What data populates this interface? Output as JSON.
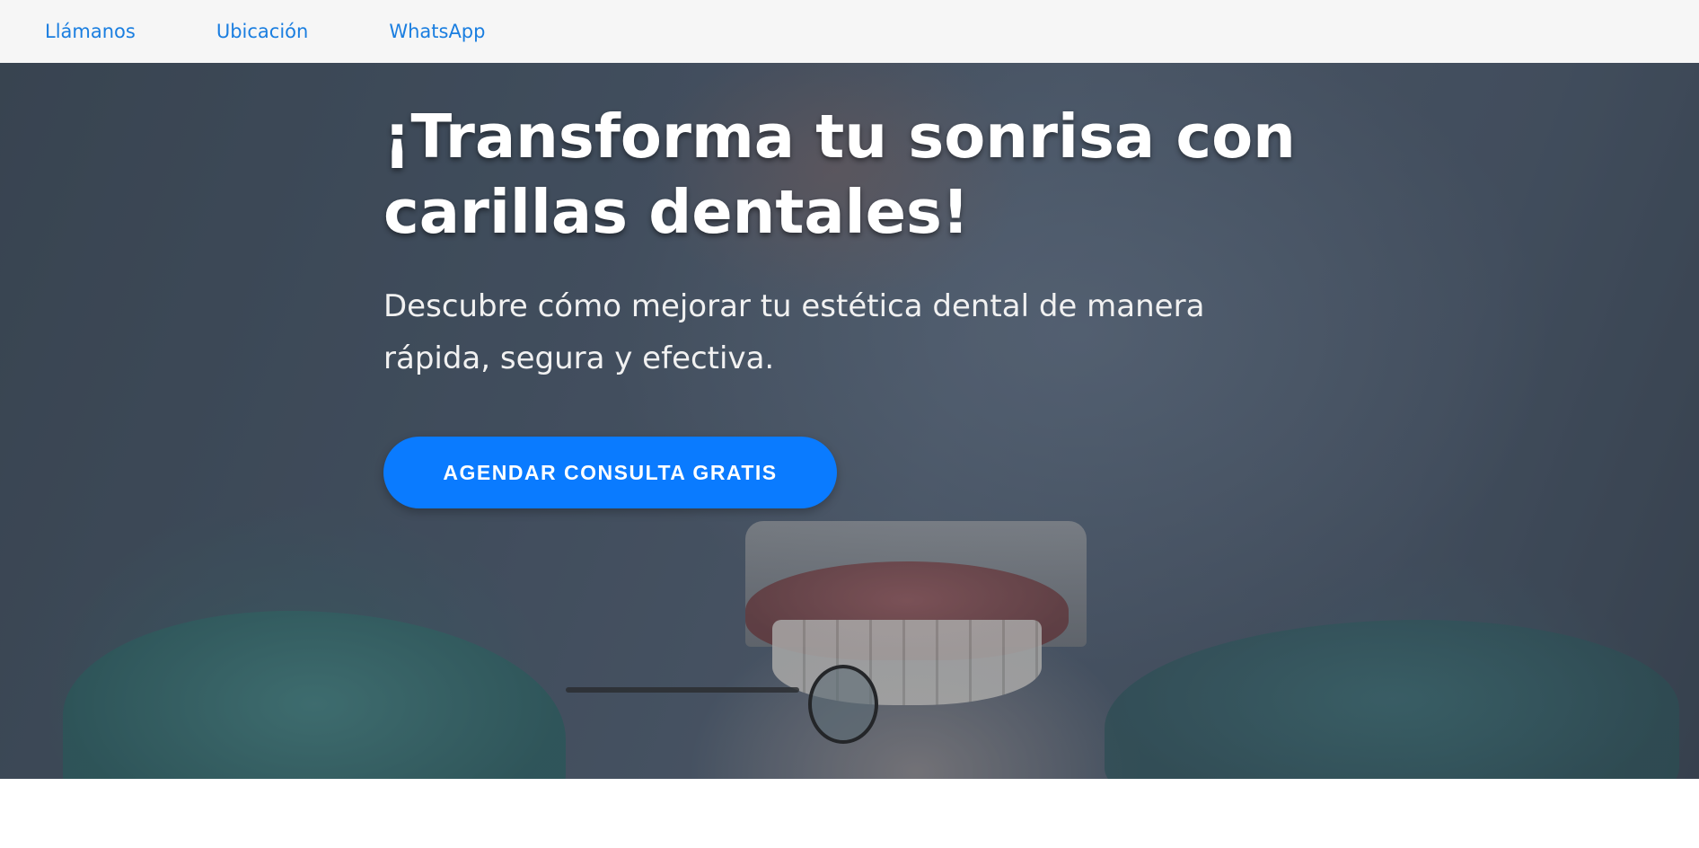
{
  "nav": {
    "items": [
      {
        "label": "Llámanos"
      },
      {
        "label": "Ubicación"
      },
      {
        "label": "WhatsApp"
      }
    ]
  },
  "hero": {
    "title": "¡Transforma tu sonrisa con carillas dentales!",
    "subtitle": "Descubre cómo mejorar tu estética dental de manera rápida, segura y efectiva.",
    "cta_label": "AGENDAR CONSULTA GRATIS"
  },
  "colors": {
    "accent": "#0a7bff",
    "nav_link": "#1a7ee0",
    "nav_background": "#f6f6f6"
  }
}
